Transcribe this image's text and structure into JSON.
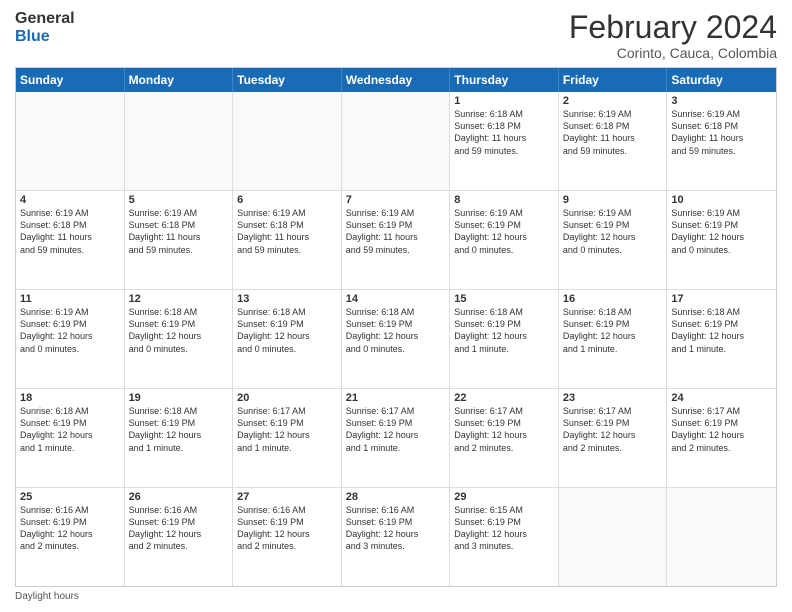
{
  "logo": {
    "line1": "General",
    "line2": "Blue"
  },
  "title": "February 2024",
  "location": "Corinto, Cauca, Colombia",
  "days_of_week": [
    "Sunday",
    "Monday",
    "Tuesday",
    "Wednesday",
    "Thursday",
    "Friday",
    "Saturday"
  ],
  "footer_label": "Daylight hours",
  "weeks": [
    [
      {
        "day": "",
        "info": "",
        "empty": true
      },
      {
        "day": "",
        "info": "",
        "empty": true
      },
      {
        "day": "",
        "info": "",
        "empty": true
      },
      {
        "day": "",
        "info": "",
        "empty": true
      },
      {
        "day": "1",
        "info": "Sunrise: 6:18 AM\nSunset: 6:18 PM\nDaylight: 11 hours\nand 59 minutes."
      },
      {
        "day": "2",
        "info": "Sunrise: 6:19 AM\nSunset: 6:18 PM\nDaylight: 11 hours\nand 59 minutes."
      },
      {
        "day": "3",
        "info": "Sunrise: 6:19 AM\nSunset: 6:18 PM\nDaylight: 11 hours\nand 59 minutes."
      }
    ],
    [
      {
        "day": "4",
        "info": "Sunrise: 6:19 AM\nSunset: 6:18 PM\nDaylight: 11 hours\nand 59 minutes."
      },
      {
        "day": "5",
        "info": "Sunrise: 6:19 AM\nSunset: 6:18 PM\nDaylight: 11 hours\nand 59 minutes."
      },
      {
        "day": "6",
        "info": "Sunrise: 6:19 AM\nSunset: 6:18 PM\nDaylight: 11 hours\nand 59 minutes."
      },
      {
        "day": "7",
        "info": "Sunrise: 6:19 AM\nSunset: 6:19 PM\nDaylight: 11 hours\nand 59 minutes."
      },
      {
        "day": "8",
        "info": "Sunrise: 6:19 AM\nSunset: 6:19 PM\nDaylight: 12 hours\nand 0 minutes."
      },
      {
        "day": "9",
        "info": "Sunrise: 6:19 AM\nSunset: 6:19 PM\nDaylight: 12 hours\nand 0 minutes."
      },
      {
        "day": "10",
        "info": "Sunrise: 6:19 AM\nSunset: 6:19 PM\nDaylight: 12 hours\nand 0 minutes."
      }
    ],
    [
      {
        "day": "11",
        "info": "Sunrise: 6:19 AM\nSunset: 6:19 PM\nDaylight: 12 hours\nand 0 minutes."
      },
      {
        "day": "12",
        "info": "Sunrise: 6:18 AM\nSunset: 6:19 PM\nDaylight: 12 hours\nand 0 minutes."
      },
      {
        "day": "13",
        "info": "Sunrise: 6:18 AM\nSunset: 6:19 PM\nDaylight: 12 hours\nand 0 minutes."
      },
      {
        "day": "14",
        "info": "Sunrise: 6:18 AM\nSunset: 6:19 PM\nDaylight: 12 hours\nand 0 minutes."
      },
      {
        "day": "15",
        "info": "Sunrise: 6:18 AM\nSunset: 6:19 PM\nDaylight: 12 hours\nand 1 minute."
      },
      {
        "day": "16",
        "info": "Sunrise: 6:18 AM\nSunset: 6:19 PM\nDaylight: 12 hours\nand 1 minute."
      },
      {
        "day": "17",
        "info": "Sunrise: 6:18 AM\nSunset: 6:19 PM\nDaylight: 12 hours\nand 1 minute."
      }
    ],
    [
      {
        "day": "18",
        "info": "Sunrise: 6:18 AM\nSunset: 6:19 PM\nDaylight: 12 hours\nand 1 minute."
      },
      {
        "day": "19",
        "info": "Sunrise: 6:18 AM\nSunset: 6:19 PM\nDaylight: 12 hours\nand 1 minute."
      },
      {
        "day": "20",
        "info": "Sunrise: 6:17 AM\nSunset: 6:19 PM\nDaylight: 12 hours\nand 1 minute."
      },
      {
        "day": "21",
        "info": "Sunrise: 6:17 AM\nSunset: 6:19 PM\nDaylight: 12 hours\nand 1 minute."
      },
      {
        "day": "22",
        "info": "Sunrise: 6:17 AM\nSunset: 6:19 PM\nDaylight: 12 hours\nand 2 minutes."
      },
      {
        "day": "23",
        "info": "Sunrise: 6:17 AM\nSunset: 6:19 PM\nDaylight: 12 hours\nand 2 minutes."
      },
      {
        "day": "24",
        "info": "Sunrise: 6:17 AM\nSunset: 6:19 PM\nDaylight: 12 hours\nand 2 minutes."
      }
    ],
    [
      {
        "day": "25",
        "info": "Sunrise: 6:16 AM\nSunset: 6:19 PM\nDaylight: 12 hours\nand 2 minutes."
      },
      {
        "day": "26",
        "info": "Sunrise: 6:16 AM\nSunset: 6:19 PM\nDaylight: 12 hours\nand 2 minutes."
      },
      {
        "day": "27",
        "info": "Sunrise: 6:16 AM\nSunset: 6:19 PM\nDaylight: 12 hours\nand 2 minutes."
      },
      {
        "day": "28",
        "info": "Sunrise: 6:16 AM\nSunset: 6:19 PM\nDaylight: 12 hours\nand 3 minutes."
      },
      {
        "day": "29",
        "info": "Sunrise: 6:15 AM\nSunset: 6:19 PM\nDaylight: 12 hours\nand 3 minutes."
      },
      {
        "day": "",
        "info": "",
        "empty": true
      },
      {
        "day": "",
        "info": "",
        "empty": true
      }
    ]
  ]
}
